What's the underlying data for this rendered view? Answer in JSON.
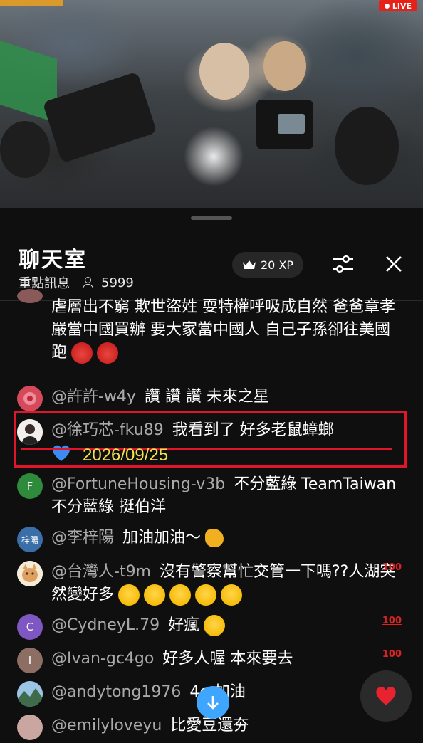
{
  "video": {
    "live_label": "LIVE"
  },
  "chat": {
    "title": "聊天室",
    "mode_label": "重點訊息",
    "viewer_count": "5999",
    "xp_label": "20 XP",
    "icons": {
      "xp": "crown-icon",
      "settings": "tune-sliders-icon",
      "close": "close-icon",
      "viewers": "person-icon"
    }
  },
  "messages": [
    {
      "author": "",
      "text": "虐層出不窮 欺世盜姓 耍特權呼吸成自然 爸爸章孝嚴當中國買辦 要大家當中國人 自己子孫卻往美國跑",
      "avatar_color": "#8a5a5a"
    },
    {
      "author": "@許許-w4y",
      "text": "讚 讚 讚 未來之星",
      "avatar_color": "#c8354f"
    },
    {
      "author": "@徐巧芯-fku89",
      "text": "我看到了 好多老鼠蟑螂",
      "avatar_color": "#e8e3df"
    },
    {
      "author": "@FortuneHousing-v3b",
      "text": "不分藍綠 TeamTaiwan 不分藍綠 挺伯洋",
      "avatar_letter": "F",
      "avatar_color": "#2e8b3c"
    },
    {
      "author": "@李梓陽",
      "text": "加油加油～",
      "avatar_letter": "梓陽",
      "avatar_color": "#3a6ea8"
    },
    {
      "author": "@台灣人-t9m",
      "text": "沒有警察幫忙交管一下嗎??人湖突然變好多",
      "avatar_color": "#f0e6d2"
    },
    {
      "author": "@CydneyL.79",
      "text": "好瘋",
      "avatar_letter": "C",
      "avatar_color": "#7e57c2"
    },
    {
      "author": "@Ivan-gc4go",
      "text": "好多人喔 本來要去",
      "avatar_letter": "I",
      "avatar_color": "#8d6e63"
    },
    {
      "author": "@andytong1976",
      "text": "4e 加油",
      "avatar_color": "#4a7fa8"
    },
    {
      "author": "@emilyloveyu",
      "text": "比愛豆還夯",
      "avatar_color": "#c9a7a0"
    }
  ],
  "overlay": {
    "date": "2026/09/25"
  },
  "badges": {
    "hundred": "100"
  }
}
